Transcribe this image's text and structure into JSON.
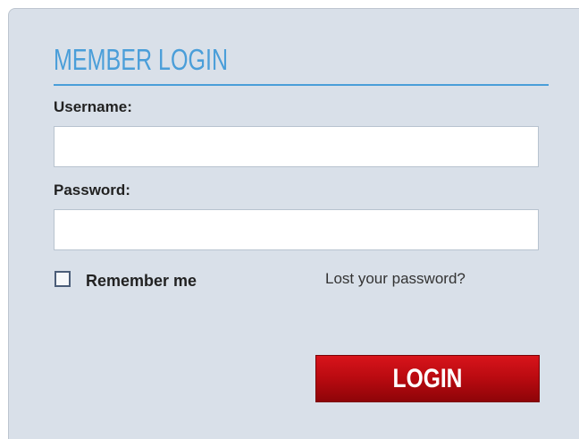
{
  "login_panel": {
    "title": "MEMBER LOGIN",
    "username": {
      "label": "Username:",
      "value": "",
      "placeholder": ""
    },
    "password": {
      "label": "Password:",
      "value": "",
      "placeholder": ""
    },
    "remember_me": {
      "label": "Remember me",
      "checked": false
    },
    "lost_password_link": "Lost your password?",
    "login_button_label": "LOGIN"
  },
  "colors": {
    "panel_background": "#d9e0e9",
    "title_accent": "#4a9ed9",
    "button_red": "#c00d14"
  }
}
